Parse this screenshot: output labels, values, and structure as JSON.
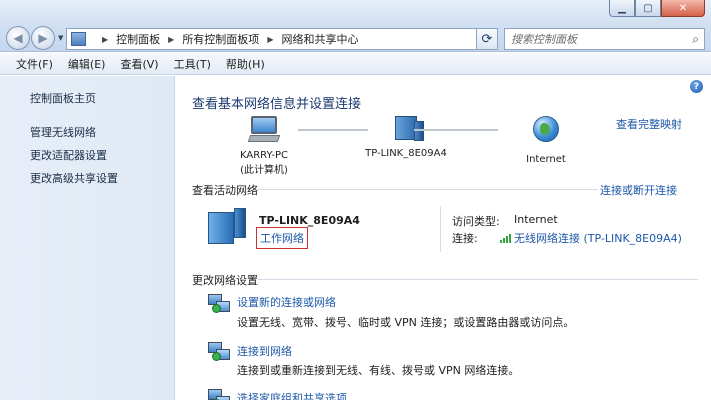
{
  "window": {
    "buttons": {
      "minimize": "▁",
      "maximize": "▢",
      "close": "✕"
    }
  },
  "nav": {
    "back_icon": "back-arrow-icon",
    "forward_icon": "forward-arrow-icon"
  },
  "address": {
    "crumbs": [
      "控制面板",
      "所有控制面板项",
      "网络和共享中心"
    ]
  },
  "search": {
    "placeholder": "搜索控制面板"
  },
  "menu": {
    "file": "文件(F)",
    "edit": "编辑(E)",
    "view": "查看(V)",
    "tools": "工具(T)",
    "help": "帮助(H)"
  },
  "sidebar": {
    "home": "控制面板主页",
    "links": [
      "管理无线网络",
      "更改适配器设置",
      "更改高级共享设置"
    ]
  },
  "main": {
    "title": "查看基本网络信息并设置连接",
    "full_map": "查看完整映射",
    "nodes": {
      "pc_name": "KARRY-PC",
      "pc_sub": "(此计算机)",
      "router": "TP-LINK_8E09A4",
      "internet": "Internet"
    },
    "active_section": "查看活动网络",
    "connect_disconnect": "连接或断开连接",
    "network": {
      "name": "TP-LINK_8E09A4",
      "type": "工作网络",
      "access_label": "访问类型:",
      "access_value": "Internet",
      "conn_label": "连接:",
      "conn_value": "无线网络连接 (TP-LINK_8E09A4)"
    },
    "change_section": "更改网络设置",
    "tasks": [
      {
        "title": "设置新的连接或网络",
        "desc": "设置无线、宽带、拨号、临时或 VPN 连接；或设置路由器或访问点。"
      },
      {
        "title": "连接到网络",
        "desc": "连接到或重新连接到无线、有线、拨号或 VPN 网络连接。"
      },
      {
        "title": "选择家庭组和共享选项",
        "desc": ""
      }
    ]
  },
  "colors": {
    "link": "#1c58a8",
    "title": "#1c3a71",
    "highlight_border": "#d03030"
  }
}
